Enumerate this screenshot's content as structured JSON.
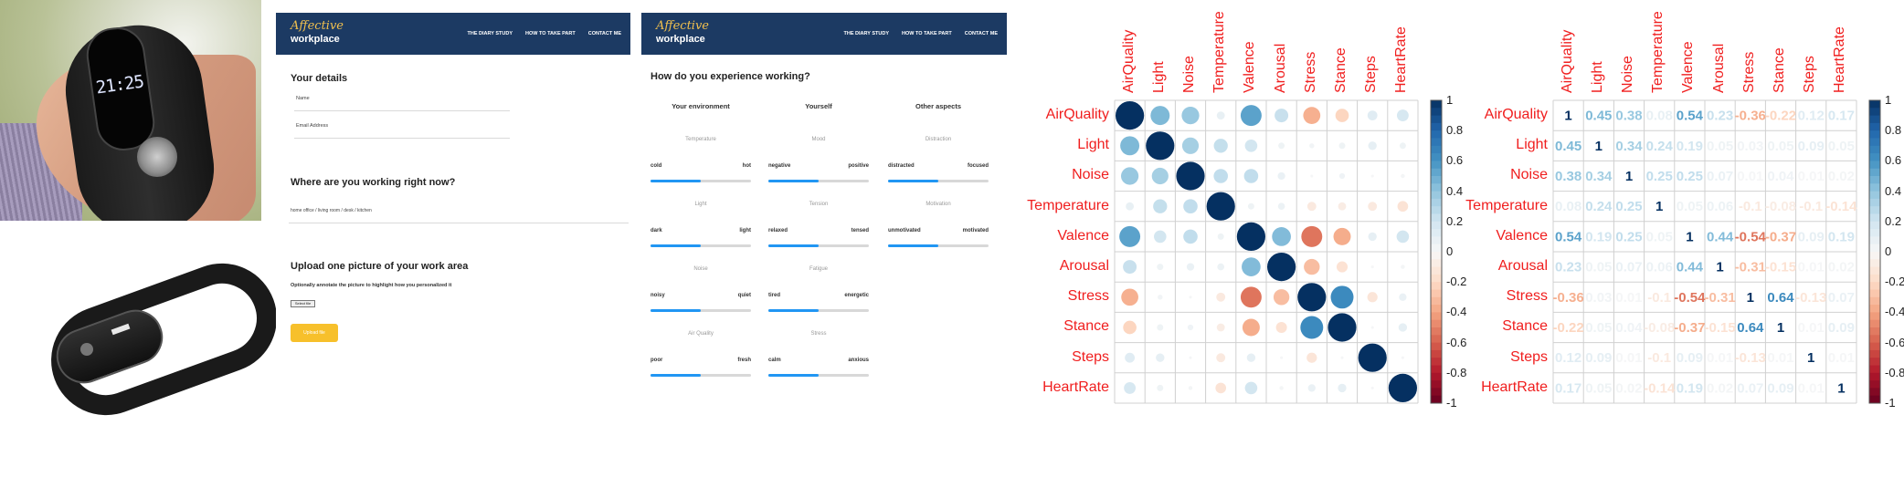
{
  "photos": {
    "top": {
      "watch_time": "21:25"
    },
    "bottom": {}
  },
  "site1": {
    "logo_line1": "Affective",
    "logo_line2": "workplace",
    "nav": [
      "THE DIARY STUDY",
      "HOW TO TAKE PART",
      "CONTACT ME"
    ],
    "details_heading": "Your details",
    "name_label": "Name",
    "email_label": "Email Address",
    "where_heading": "Where are you working right now?",
    "where_value": "home office / living room / desk / kitchen",
    "upload_heading": "Upload one picture of your work area",
    "upload_sub": "Optionally annotate the picture to highlight how you personalized it",
    "select_file": "Select file",
    "upload_button": "Upload file"
  },
  "site2": {
    "logo_line1": "Affective",
    "logo_line2": "workplace",
    "nav": [
      "THE DIARY STUDY",
      "HOW TO TAKE PART",
      "CONTACT ME"
    ],
    "question": "How do you experience working?",
    "columns": [
      {
        "title": "Your environment",
        "items": [
          {
            "category": "Temperature",
            "left": "cold",
            "right": "hot",
            "level": 0.5
          },
          {
            "category": "Light",
            "left": "dark",
            "right": "light",
            "level": 0.5
          },
          {
            "category": "Noise",
            "left": "noisy",
            "right": "quiet",
            "level": 0.5
          },
          {
            "category": "Air Quality",
            "left": "poor",
            "right": "fresh",
            "level": 0.5
          }
        ]
      },
      {
        "title": "Yourself",
        "items": [
          {
            "category": "Mood",
            "left": "negative",
            "right": "positive",
            "level": 0.5
          },
          {
            "category": "Tension",
            "left": "relaxed",
            "right": "tensed",
            "level": 0.5
          },
          {
            "category": "Fatigue",
            "left": "tired",
            "right": "energetic",
            "level": 0.5
          },
          {
            "category": "Stress",
            "left": "calm",
            "right": "anxious",
            "level": 0.5
          }
        ]
      },
      {
        "title": "Other aspects",
        "items": [
          {
            "category": "Distraction",
            "left": "distracted",
            "right": "focused",
            "level": 0.5
          },
          {
            "category": "Motivation",
            "left": "unmotivated",
            "right": "motivated",
            "level": 0.5
          }
        ]
      }
    ]
  },
  "chart_data": [
    {
      "type": "heatmap",
      "variables": [
        "AirQuality",
        "Light",
        "Noise",
        "Temperature",
        "Valence",
        "Arousal",
        "Stress",
        "Stance",
        "Steps",
        "HeartRate"
      ],
      "matrix": [
        [
          1,
          0.45,
          0.38,
          0.08,
          0.54,
          0.23,
          -0.36,
          -0.22,
          0.12,
          0.17
        ],
        [
          0.45,
          1,
          0.34,
          0.24,
          0.19,
          0.05,
          0.03,
          0.05,
          0.09,
          0.05
        ],
        [
          0.38,
          0.34,
          1,
          0.25,
          0.25,
          0.07,
          0.01,
          0.04,
          0.01,
          0.02
        ],
        [
          0.08,
          0.24,
          0.25,
          1,
          0.05,
          0.06,
          -0.1,
          -0.08,
          -0.1,
          -0.14
        ],
        [
          0.54,
          0.19,
          0.25,
          0.05,
          1,
          0.44,
          -0.54,
          -0.37,
          0.09,
          0.19
        ],
        [
          0.23,
          0.05,
          0.07,
          0.06,
          0.44,
          1,
          -0.31,
          -0.15,
          0.01,
          0.02
        ],
        [
          -0.36,
          0.03,
          0.01,
          -0.1,
          -0.54,
          -0.31,
          1,
          0.64,
          -0.13,
          0.07
        ],
        [
          -0.22,
          0.05,
          0.04,
          -0.08,
          -0.37,
          -0.15,
          0.64,
          1,
          0.01,
          0.09
        ],
        [
          0.12,
          0.09,
          0.01,
          -0.1,
          0.09,
          0.01,
          -0.13,
          0.01,
          1,
          0.01
        ],
        [
          0.17,
          0.05,
          0.02,
          -0.14,
          0.19,
          0.02,
          0.07,
          0.09,
          0.01,
          1
        ]
      ],
      "method": "circle",
      "colorbar_ticks": [
        "1",
        "0.8",
        "0.6",
        "0.4",
        "0.2",
        "0",
        "-0.2",
        "-0.4",
        "-0.6",
        "-0.8",
        "-1"
      ],
      "colors": {
        "positive": "#053061",
        "negative": "#67001f",
        "label": "#f01e1e"
      }
    },
    {
      "type": "heatmap",
      "variables": [
        "AirQuality",
        "Light",
        "Noise",
        "Temperature",
        "Valence",
        "Arousal",
        "Stress",
        "Stance",
        "Steps",
        "HeartRate"
      ],
      "matrix": [
        [
          1,
          0.45,
          0.38,
          0.08,
          0.54,
          0.23,
          -0.36,
          -0.22,
          0.12,
          0.17
        ],
        [
          0.45,
          1,
          0.34,
          0.24,
          0.19,
          0.05,
          0.03,
          0.05,
          0.09,
          0.05
        ],
        [
          0.38,
          0.34,
          1,
          0.25,
          0.25,
          0.07,
          0.01,
          0.04,
          0.01,
          0.02
        ],
        [
          0.08,
          0.24,
          0.25,
          1,
          0.05,
          0.06,
          -0.1,
          -0.08,
          -0.1,
          -0.14
        ],
        [
          0.54,
          0.19,
          0.25,
          0.05,
          1,
          0.44,
          -0.54,
          -0.37,
          0.09,
          0.19
        ],
        [
          0.23,
          0.05,
          0.07,
          0.06,
          0.44,
          1,
          -0.31,
          -0.15,
          0.01,
          0.02
        ],
        [
          -0.36,
          0.03,
          0.01,
          -0.1,
          -0.54,
          -0.31,
          1,
          0.64,
          -0.13,
          0.07
        ],
        [
          -0.22,
          0.05,
          0.04,
          -0.08,
          -0.37,
          -0.15,
          0.64,
          1,
          0.01,
          0.09
        ],
        [
          0.12,
          0.09,
          0.01,
          -0.1,
          0.09,
          0.01,
          -0.13,
          0.01,
          1,
          0.01
        ],
        [
          0.17,
          0.05,
          0.02,
          -0.14,
          0.19,
          0.02,
          0.07,
          0.09,
          0.01,
          1
        ]
      ],
      "method": "number",
      "colorbar_ticks": [
        "1",
        "0.8",
        "0.6",
        "0.4",
        "0.2",
        "0",
        "-0.2",
        "-0.4",
        "-0.6",
        "-0.8",
        "-1"
      ],
      "colors": {
        "positive": "#053061",
        "negative": "#67001f",
        "label": "#f01e1e"
      }
    }
  ]
}
